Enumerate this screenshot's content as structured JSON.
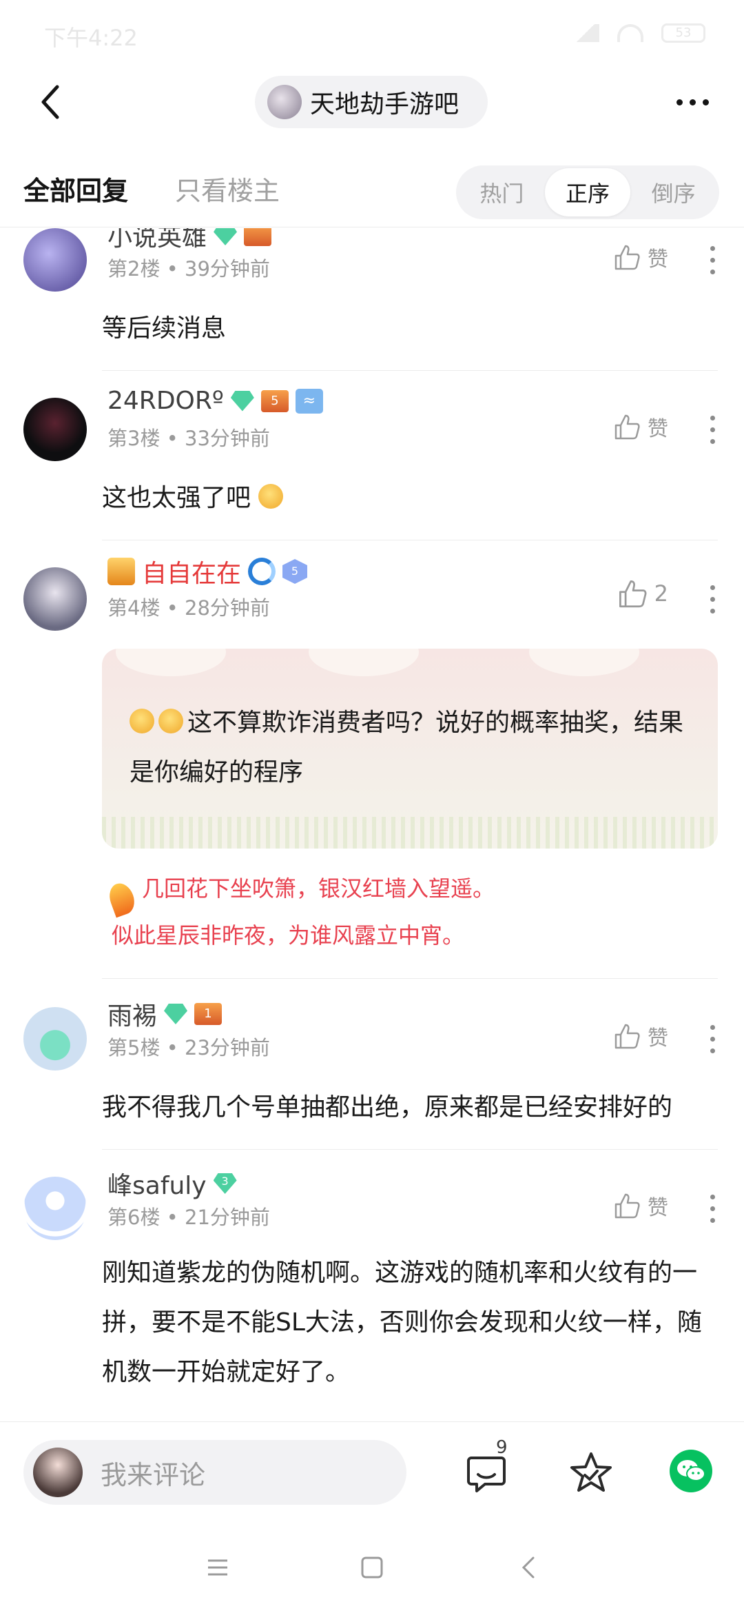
{
  "status_bar": {
    "time": "下午4:22",
    "battery": "53"
  },
  "header": {
    "back_icon": "chevron-left-icon",
    "forum_name": "天地劫手游吧",
    "more_icon": "more-horizontal-icon"
  },
  "tabs": {
    "all_replies": "全部回复",
    "owner_only": "只看楼主",
    "sort_options": [
      "热门",
      "正序",
      "倒序"
    ],
    "selected_sort": "正序"
  },
  "posts": [
    {
      "username": "小说英雄",
      "floor": "第2楼",
      "time": "39分钟前",
      "like_label": "赞",
      "content": "等后续消息"
    },
    {
      "username": "24RDORº",
      "badge_level": "5",
      "floor": "第3楼",
      "time": "33分钟前",
      "like_label": "赞",
      "content": "这也太强了吧"
    },
    {
      "username": "自自在在",
      "badge_level": "5",
      "floor": "第4楼",
      "time": "28分钟前",
      "like_count": "2",
      "content": "这不算欺诈消费者吗？说好的概率抽奖，结果是你编好的程序",
      "signature_line1": "几回花下坐吹箫，银汉红墙入望遥。",
      "signature_line2": "似此星辰非昨夜，为谁风露立中宵。"
    },
    {
      "username": "雨裼",
      "badge_level": "1",
      "floor": "第5楼",
      "time": "23分钟前",
      "like_label": "赞",
      "content": "我不得我几个号单抽都出绝，原来都是已经安排好的"
    },
    {
      "username": "峰safuly",
      "badge_level": "3",
      "floor": "第6楼",
      "time": "21分钟前",
      "like_label": "赞",
      "content": "刚知道紫龙的伪随机啊。这游戏的随机率和火纹有的一拼，要不是不能SL大法，否则你会发现和火纹一样，随机数一开始就定好了。"
    }
  ],
  "bottom_bar": {
    "comment_placeholder": "我来评论",
    "comment_count": "9",
    "comment_icon": "comment-icon",
    "favorite_icon": "star-icon",
    "share_icon": "wechat-icon"
  },
  "nav_bar": {
    "icons": [
      "menu-icon",
      "home-icon",
      "back-icon"
    ]
  },
  "colors": {
    "accent_green": "#07c160",
    "username_red": "#e53a3a",
    "signature_red": "#e8414f"
  }
}
